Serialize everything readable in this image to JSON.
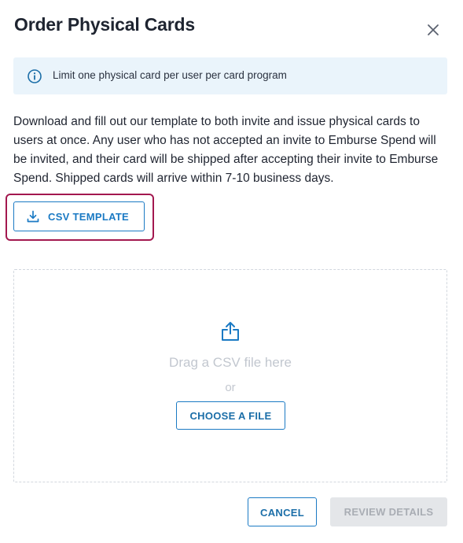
{
  "dialog": {
    "title": "Order Physical Cards",
    "close_icon": "close-icon"
  },
  "info_banner": {
    "icon": "info-icon",
    "text": "Limit one physical card per user per card program"
  },
  "description": "Download and fill out our template to both invite and issue physical cards to users at once. Any user who has not accepted an invite to Emburse Spend will be invited, and their card will be shipped after accepting their invite to Emburse Spend. Shipped cards will arrive within 7-10 business days.",
  "csv_template_button": {
    "icon": "download-icon",
    "label": "CSV TEMPLATE"
  },
  "dropzone": {
    "icon": "upload-icon",
    "drag_text": "Drag a CSV file here",
    "or_text": "or",
    "choose_button_label": "CHOOSE A FILE"
  },
  "footer": {
    "cancel_label": "CANCEL",
    "review_label": "REVIEW DETAILS",
    "review_disabled": true
  },
  "colors": {
    "accent": "#1b7ac4",
    "highlight": "#a3184f",
    "info_background": "#eaf4fb",
    "disabled_background": "#e4e6e9"
  }
}
